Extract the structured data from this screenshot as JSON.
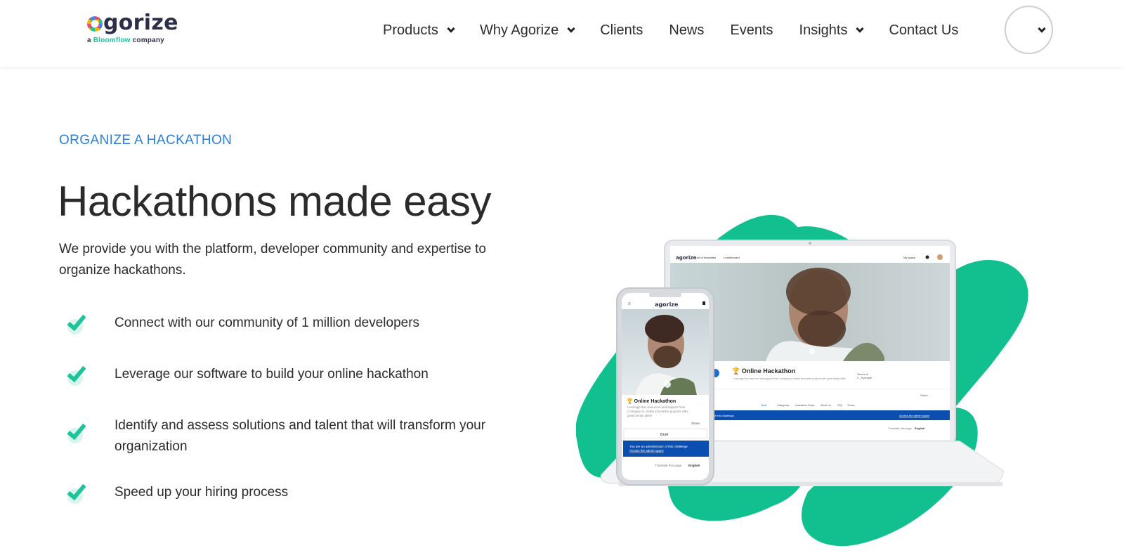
{
  "header": {
    "logo": {
      "word": "agorize",
      "subtitle_prefix": "a ",
      "subtitle_brand": "Bloomflow",
      "subtitle_suffix": " company"
    },
    "nav": [
      {
        "label": "Products",
        "has_dropdown": true
      },
      {
        "label": "Why Agorize",
        "has_dropdown": true
      },
      {
        "label": "Clients",
        "has_dropdown": false
      },
      {
        "label": "News",
        "has_dropdown": false
      },
      {
        "label": "Events",
        "has_dropdown": false
      },
      {
        "label": "Insights",
        "has_dropdown": true
      },
      {
        "label": "Contact Us",
        "has_dropdown": false
      }
    ],
    "language_icon": "chevron-down-icon"
  },
  "hero": {
    "eyebrow": "ORGANIZE A HACKATHON",
    "title": "Hackathons made easy",
    "description": "We provide you with the platform, developer community and expertise to organize hackathons.",
    "features": [
      "Connect with our community of 1 million developers",
      "Leverage our software to build your online hackathon",
      "Identify and assess solutions and talent that will transform your organization",
      "Speed up your hiring process"
    ]
  },
  "mockup": {
    "laptop": {
      "nav_logo": "agorize",
      "nav_links": [
        "List of templates",
        "Leaderboard"
      ],
      "nav_right": "My space",
      "card_title": "Online Hackathon",
      "card_desc": "Leverage the resources and support from Company to create innovative projects with great minds alike!",
      "teams": "Teams of",
      "team_size": "2 - 5 people",
      "share": "Share",
      "tabs": [
        "Brief",
        "Categories",
        "Hackathon Steps",
        "About Us",
        "FAQ",
        "Teams"
      ],
      "admin_text": "...inistrator of this challenge.",
      "admin_link": "Access the admin space",
      "translate": "Translate this page",
      "lang": "English"
    },
    "phone": {
      "logo": "agorize",
      "card_title": "Online Hackathon",
      "card_desc": "Leverage the resources and support from Company to create innovative projects with great minds alike!",
      "share": "Share",
      "select": "Brief",
      "admin_text": "You are an administrator of this challenge.",
      "admin_link": "Access the admin space",
      "translate": "Translate this page",
      "lang": "English"
    },
    "colors": {
      "accent_green": "#1dc49a",
      "brand_blue": "#0a4fb0",
      "eyebrow_blue": "#2f7fd6"
    }
  }
}
